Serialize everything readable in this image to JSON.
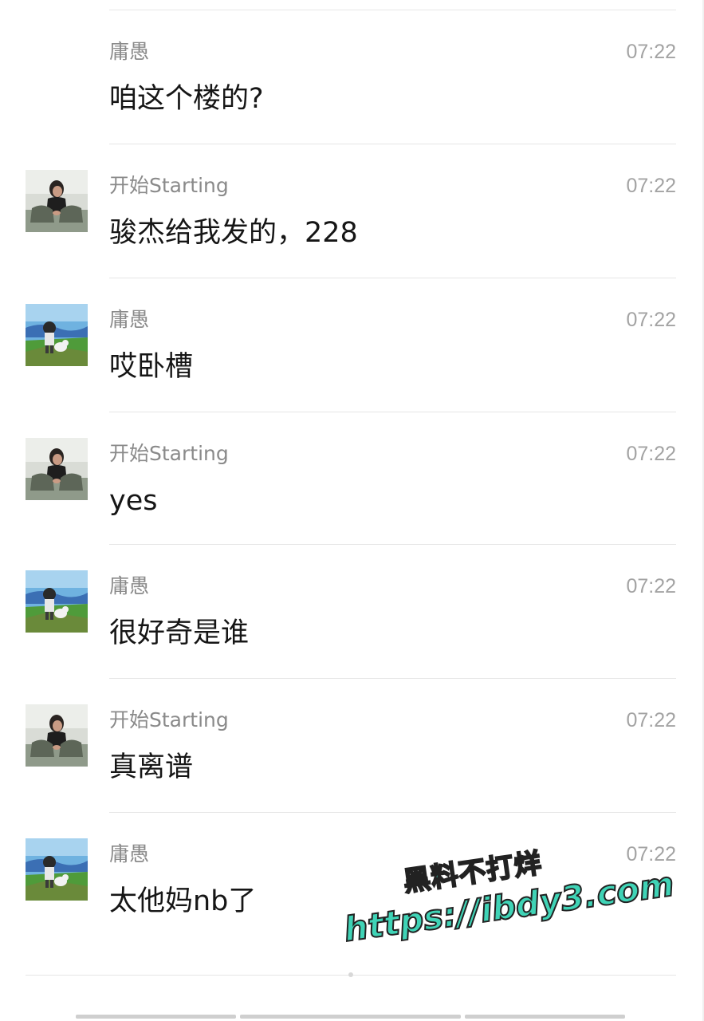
{
  "messages": [
    {
      "sender": "庸愚",
      "time": "07:22",
      "text": "咱这个楼的?",
      "avatar": "none"
    },
    {
      "sender": "开始Starting",
      "time": "07:22",
      "text": "骏杰给我发的，228",
      "avatar": "person-avatar"
    },
    {
      "sender": "庸愚",
      "time": "07:22",
      "text": "哎卧槽",
      "avatar": "cartoon-avatar"
    },
    {
      "sender": "开始Starting",
      "time": "07:22",
      "text": "yes",
      "avatar": "person-avatar"
    },
    {
      "sender": "庸愚",
      "time": "07:22",
      "text": "很好奇是谁",
      "avatar": "cartoon-avatar"
    },
    {
      "sender": "开始Starting",
      "time": "07:22",
      "text": "真离谱",
      "avatar": "person-avatar"
    },
    {
      "sender": "庸愚",
      "time": "07:22",
      "text": "太他妈nb了",
      "avatar": "cartoon-avatar"
    }
  ],
  "watermark": {
    "line1": "黑料不打烊",
    "line2": "https://ibdy3.com"
  },
  "colors": {
    "sender": "#8a8a8a",
    "time": "#a3a3a3",
    "text": "#161616",
    "divider": "#e6e6e6",
    "watermark": "#3fd3b6"
  }
}
